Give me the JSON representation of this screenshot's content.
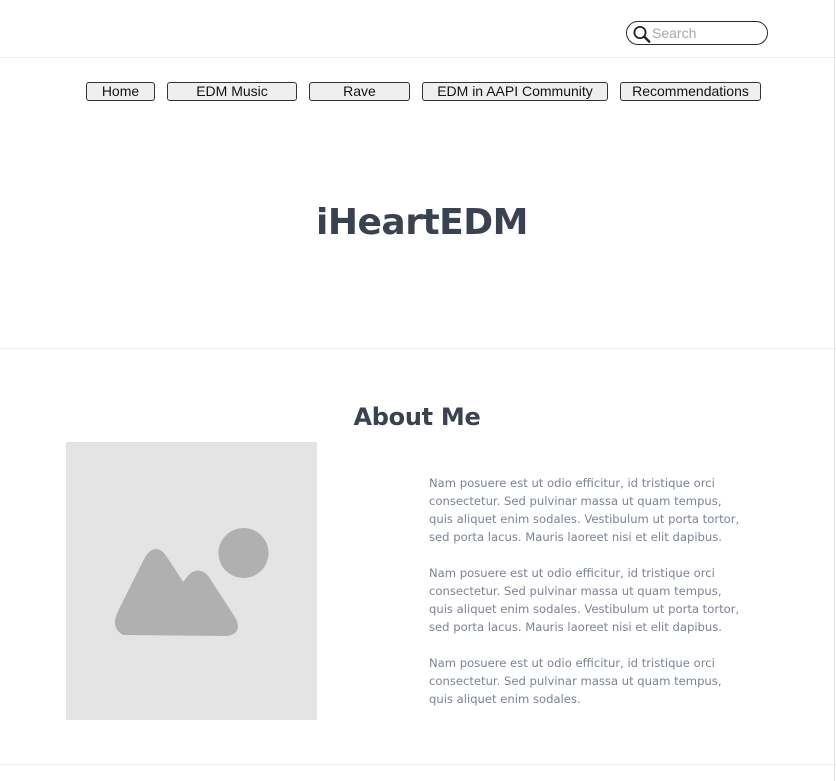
{
  "search": {
    "placeholder": "Search",
    "value": ""
  },
  "nav": {
    "items": [
      {
        "label": "Home"
      },
      {
        "label": "EDM Music"
      },
      {
        "label": "Rave"
      },
      {
        "label": "EDM in AAPI Community"
      },
      {
        "label": "Recommendations"
      }
    ]
  },
  "hero": {
    "title": "iHeartEDM"
  },
  "about": {
    "title": "About Me",
    "image_icon": "image-placeholder-icon",
    "paragraphs": [
      "Nam posuere est ut odio efficitur, id tristique orci consectetur. Sed pulvinar massa ut quam tempus, quis aliquet enim sodales. Vestibulum ut porta tortor, sed porta lacus. Mauris laoreet nisi et elit dapibus.",
      "Nam posuere est ut odio efficitur, id tristique orci consectetur. Sed pulvinar massa ut quam tempus, quis aliquet enim sodales. Vestibulum ut porta tortor, sed porta lacus. Mauris laoreet nisi et elit dapibus.",
      "Nam posuere est ut odio efficitur, id tristique orci consectetur. Sed pulvinar massa ut quam tempus, quis aliquet enim sodales."
    ]
  },
  "colors": {
    "heading": "#3a4252",
    "body_text": "#7b8494",
    "placeholder_bg": "#e4e4e4",
    "placeholder_shape": "#b0b0b0",
    "button_bg": "#efefef"
  }
}
